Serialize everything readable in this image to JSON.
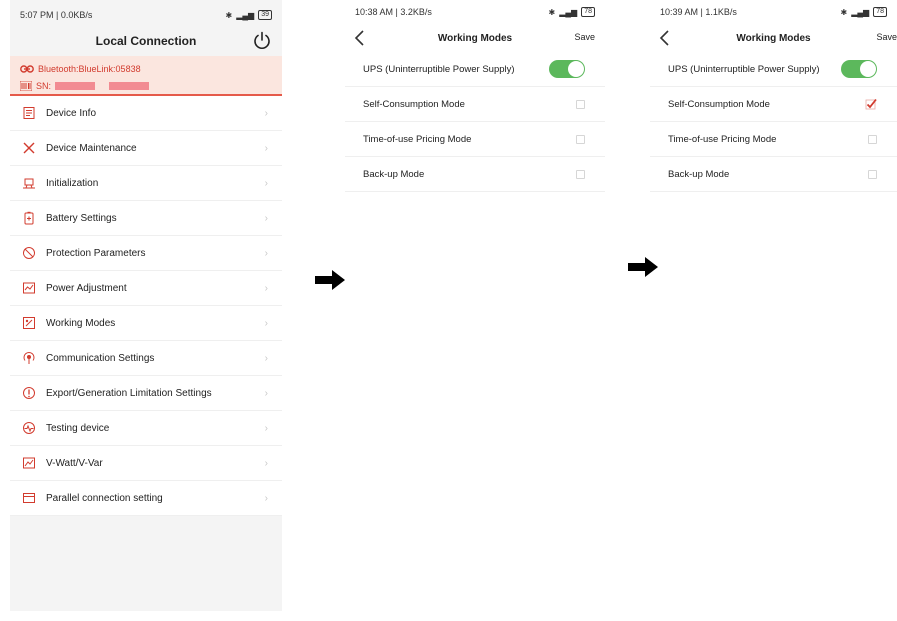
{
  "screen1": {
    "status_time": "5:07 PM | 0.0KB/s",
    "battery": "39",
    "title": "Local Connection",
    "bluetooth": "Bluetooth:BlueLink:05838",
    "sn_label": "SN:",
    "menu": [
      {
        "label": "Device Info",
        "icon": "device-info-icon"
      },
      {
        "label": "Device Maintenance",
        "icon": "tools-icon"
      },
      {
        "label": "Initialization",
        "icon": "initialization-icon"
      },
      {
        "label": "Battery Settings",
        "icon": "battery-icon"
      },
      {
        "label": "Protection Parameters",
        "icon": "protection-icon"
      },
      {
        "label": "Power Adjustment",
        "icon": "power-adjustment-icon"
      },
      {
        "label": "Working Modes",
        "icon": "working-modes-icon"
      },
      {
        "label": "Communication Settings",
        "icon": "communication-icon"
      },
      {
        "label": "Export/Generation Limitation Settings",
        "icon": "export-limit-icon"
      },
      {
        "label": "Testing device",
        "icon": "testing-icon"
      },
      {
        "label": "V-Watt/V-Var",
        "icon": "chart-icon"
      },
      {
        "label": "Parallel connection setting",
        "icon": "parallel-icon"
      }
    ]
  },
  "screen2": {
    "status_time": "10:38 AM | 3.2KB/s",
    "battery": "78",
    "title": "Working Modes",
    "save": "Save",
    "modes": [
      {
        "label": "UPS (Uninterruptible Power Supply)",
        "control": "toggle",
        "on": true
      },
      {
        "label": "Self-Consumption Mode",
        "control": "checkbox",
        "on": false
      },
      {
        "label": "Time-of-use Pricing Mode",
        "control": "checkbox",
        "on": false
      },
      {
        "label": "Back-up Mode",
        "control": "checkbox",
        "on": false
      }
    ]
  },
  "screen3": {
    "status_time": "10:39 AM | 1.1KB/s",
    "battery": "78",
    "title": "Working Modes",
    "save": "Save",
    "modes": [
      {
        "label": "UPS (Uninterruptible Power Supply)",
        "control": "toggle",
        "on": true
      },
      {
        "label": "Self-Consumption Mode",
        "control": "checkbox",
        "on": true
      },
      {
        "label": "Time-of-use Pricing Mode",
        "control": "checkbox",
        "on": false
      },
      {
        "label": "Back-up Mode",
        "control": "checkbox",
        "on": false
      }
    ]
  },
  "colors": {
    "accent_red": "#d23b2e",
    "toggle_green": "#5cb85c",
    "panel_pink": "#fbe6df"
  }
}
